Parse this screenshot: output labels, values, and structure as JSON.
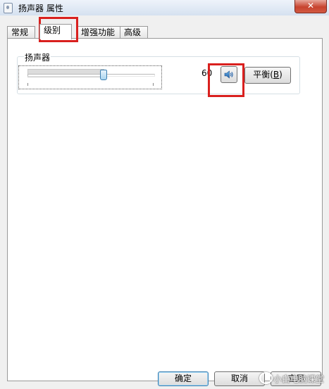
{
  "window": {
    "title": "扬声器 属性",
    "close_label": "✕",
    "app_icon": "speaker-properties-icon"
  },
  "tabs": [
    {
      "label": "常规",
      "active": false
    },
    {
      "label": "级别",
      "active": true
    },
    {
      "label": "增强功能",
      "active": false
    },
    {
      "label": "高级",
      "active": false
    }
  ],
  "level_group": {
    "title": "扬声器",
    "volume": 60,
    "volume_text": "60",
    "mute_icon": "speaker-volume-icon",
    "balance_label": "平衡",
    "balance_accel_open": "(",
    "balance_accel_key": "B",
    "balance_accel_close": ")"
  },
  "footer": {
    "ok_label": "确定",
    "cancel_label": "取消",
    "apply_label": "应用"
  },
  "watermark": {
    "text": "小白电脑课堂"
  },
  "colors": {
    "highlight": "#d9201e",
    "slider_thumb": "#a9d4ef"
  }
}
